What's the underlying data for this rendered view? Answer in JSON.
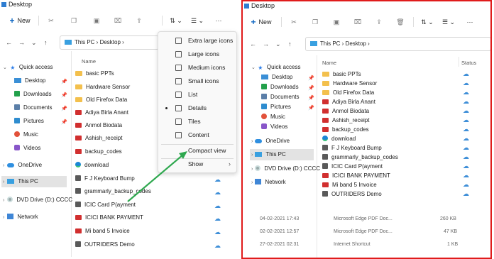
{
  "left_window": {
    "title": "Desktop",
    "toolbar": {
      "new_label": "New"
    },
    "breadcrumb": [
      "This PC",
      "Desktop"
    ],
    "column_name": "Name",
    "nav": {
      "quick_access": "Quick access",
      "pinned": [
        "Desktop",
        "Downloads",
        "Documents",
        "Pictures",
        "Music",
        "Videos"
      ],
      "onedrive": "OneDrive",
      "this_pc": "This PC",
      "dvd": "DVD Drive (D:) CCCC",
      "network": "Network"
    },
    "files": [
      "basic PPTs",
      "Hardware Sensor",
      "Old Firefox Data",
      "Adiya Birla Anant",
      "Anmol Biodata",
      "Ashish_receipt",
      "backup_codes",
      "download",
      "F J Keyboard Bump",
      "grammarly_backup_codes",
      "ICIC Card P(ayment",
      "ICICI BANK PAYMENT",
      "Mi band 5 Invoice",
      "OUTRIDERS Demo"
    ],
    "view_menu": {
      "items": [
        "Extra large icons",
        "Large icons",
        "Medium icons",
        "Small icons",
        "List",
        "Details",
        "Tiles",
        "Content",
        "Compact view",
        "Show"
      ],
      "selected": "Details"
    }
  },
  "right_window": {
    "title": "Desktop",
    "toolbar": {
      "new_label": "New"
    },
    "breadcrumb": [
      "This PC",
      "Desktop"
    ],
    "column_name": "Name",
    "column_status": "Status",
    "nav": {
      "quick_access": "Quick access",
      "pinned": [
        "Desktop",
        "Downloads",
        "Documents",
        "Pictures",
        "Music",
        "Videos"
      ],
      "onedrive": "OneDrive",
      "this_pc": "This PC",
      "dvd": "DVD Drive (D:) CCCC",
      "network": "Network"
    },
    "files": [
      "basic PPTs",
      "Hardware Sensor",
      "Old Firefox Data",
      "Adiya Birla Anant",
      "Anmol Biodata",
      "Ashish_receipt",
      "backup_codes",
      "download",
      "F J Keyboard Bump",
      "grammarly_backup_codes",
      "ICIC Card P(ayment",
      "ICICI BANK PAYMENT",
      "Mi band 5 Invoice",
      "OUTRIDERS Demo"
    ],
    "detail_rows": [
      {
        "date": "04-02-2021 17:43",
        "type": "Microsoft Edge PDF Doc...",
        "size": "260 KB"
      },
      {
        "date": "02-02-2021 12:57",
        "type": "Microsoft Edge PDF Doc...",
        "size": "47 KB"
      },
      {
        "date": "27-02-2021 02:31",
        "type": "Internet Shortcut",
        "size": "1 KB"
      }
    ]
  },
  "colors": {
    "highlight_border": "#e01b1b",
    "arrow": "#2fa84f",
    "cloud": "#3f8fd8"
  }
}
